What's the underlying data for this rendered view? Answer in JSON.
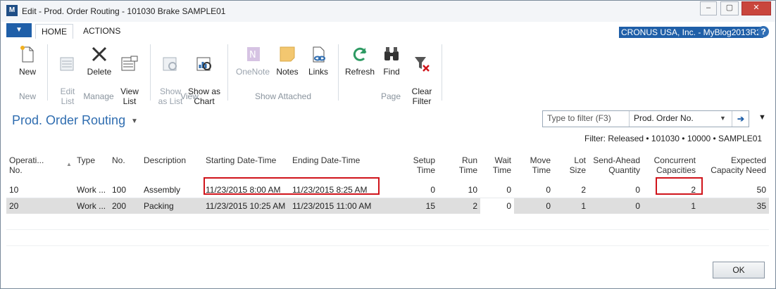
{
  "window": {
    "title": "Edit - Prod. Order Routing - 101030 Brake SAMPLE01",
    "app_icon": "nav-logo-icon",
    "controls": [
      "minimize-icon",
      "maximize-icon",
      "close-icon"
    ]
  },
  "ribbon_tabs": {
    "app_menu": "▼",
    "tabs": [
      {
        "label": "HOME"
      },
      {
        "label": "ACTIONS"
      }
    ],
    "company": "CRONUS USA, Inc. - MyBlog2013R2",
    "help": "?"
  },
  "ribbon": {
    "new": {
      "label": "New",
      "icon": "new-document-icon"
    },
    "group_new": "New",
    "edit_list": {
      "label": "Edit\nList",
      "icon": "edit-list-icon"
    },
    "delete": {
      "label": "Delete",
      "icon": "delete-x-icon"
    },
    "view_list": {
      "label": "View\nList",
      "icon": "view-list-icon"
    },
    "group_manage": "Manage",
    "show_as_list": {
      "label": "Show\nas List",
      "icon": "show-as-list-icon"
    },
    "show_as_chart": {
      "label": "Show as\nChart",
      "icon": "show-as-chart-icon"
    },
    "group_view": "View",
    "onenote": {
      "label": "OneNote",
      "icon": "onenote-icon"
    },
    "notes": {
      "label": "Notes",
      "icon": "notes-icon"
    },
    "links": {
      "label": "Links",
      "icon": "links-icon"
    },
    "group_show_attached": "Show Attached",
    "refresh": {
      "label": "Refresh",
      "icon": "refresh-icon"
    },
    "find": {
      "label": "Find",
      "icon": "binoculars-icon"
    },
    "clear_filter": {
      "label": "Clear\nFilter",
      "icon": "clear-filter-icon"
    },
    "group_page": "Page"
  },
  "page": {
    "title": "Prod. Order Routing",
    "filter_placeholder": "Type to filter (F3)",
    "filter_field": "Prod. Order No.",
    "filter_summary": "Filter: Released • 101030 • 10000 • SAMPLE01"
  },
  "grid": {
    "columns": {
      "operation_no": "Operati...\nNo.",
      "type": "Type",
      "no": "No.",
      "description": "Description",
      "starting": "Starting Date-Time",
      "ending": "Ending Date-Time",
      "setup": "Setup\nTime",
      "run": "Run\nTime",
      "wait": "Wait\nTime",
      "move": "Move\nTime",
      "lot": "Lot Size",
      "send_ahead": "Send-Ahead\nQuantity",
      "concurrent": "Concurrent\nCapacities",
      "expected": "Expected\nCapacity Need"
    },
    "rows": [
      {
        "operation_no": "10",
        "type": "Work ...",
        "no": "100",
        "description": "Assembly",
        "starting": "11/23/2015 8:00 AM",
        "ending": "11/23/2015 8:25 AM",
        "setup": "0",
        "run": "10",
        "wait": "0",
        "move": "0",
        "lot": "2",
        "send_ahead": "0",
        "concurrent": "2",
        "expected": "50"
      },
      {
        "operation_no": "20",
        "type": "Work ...",
        "no": "200",
        "description": "Packing",
        "starting": "11/23/2015 10:25 AM",
        "ending": "11/23/2015 11:00 AM",
        "setup": "15",
        "run": "2",
        "wait": "0",
        "move": "0",
        "lot": "1",
        "send_ahead": "0",
        "concurrent": "1",
        "expected": "35"
      }
    ]
  },
  "footer": {
    "ok": "OK"
  }
}
